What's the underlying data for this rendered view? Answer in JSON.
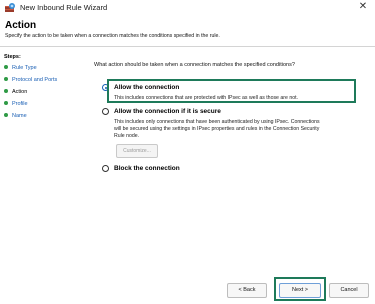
{
  "window": {
    "title": "New Inbound Rule Wizard",
    "close_glyph": "✕"
  },
  "header": {
    "title": "Action",
    "subtitle": "Specify the action to be taken when a connection matches the conditions specified in the rule."
  },
  "steps": {
    "title": "Steps:",
    "items": [
      {
        "label": "Rule Type",
        "state": "link"
      },
      {
        "label": "Protocol and Ports",
        "state": "link"
      },
      {
        "label": "Action",
        "state": "current"
      },
      {
        "label": "Profile",
        "state": "link"
      },
      {
        "label": "Name",
        "state": "link"
      }
    ]
  },
  "main": {
    "question": "What action should be taken when a connection matches the specified conditions?",
    "options": [
      {
        "label": "Allow the connection",
        "description": "This includes connections that are protected with IPsec as well as those are not.",
        "selected": true
      },
      {
        "label": "Allow the connection if it is secure",
        "description_lines": [
          "This includes only connections that have been authenticated by using IPsec.  Connections",
          "will be secured using the settings in IPsec properties and rules in the Connection Security",
          "Rule node."
        ],
        "selected": false
      },
      {
        "label": "Block the connection",
        "selected": false
      }
    ],
    "customize_label": "Customize..."
  },
  "footer": {
    "back_label": "< Back",
    "next_label": "Next >",
    "cancel_label": "Cancel"
  },
  "colors": {
    "link": "#1a5fb4",
    "step_dot": "#2e9a45",
    "highlight": "#1e7a5a",
    "radio_selected": "#1660b5"
  },
  "icons": {
    "app": "firewall-wizard-icon",
    "close": "close-icon"
  }
}
